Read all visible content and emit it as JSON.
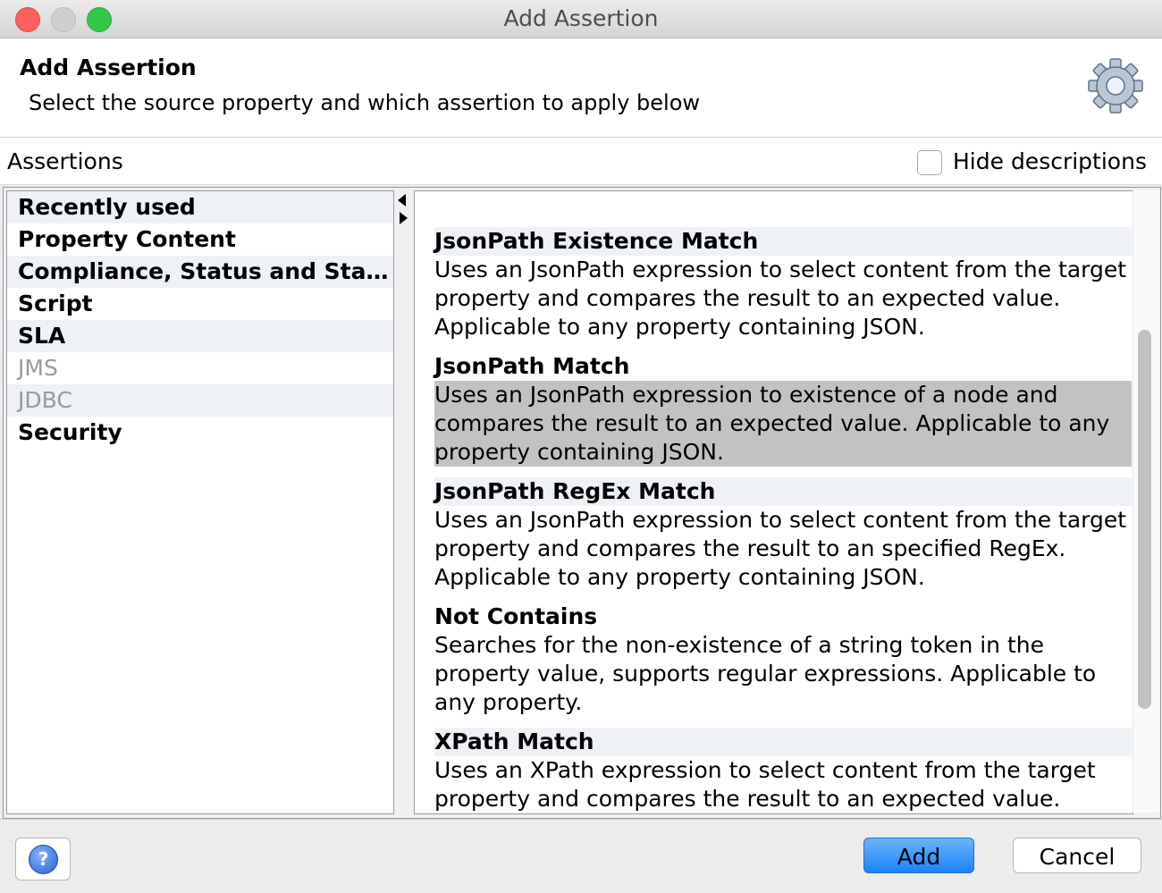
{
  "window": {
    "title": "Add Assertion"
  },
  "header": {
    "title": "Add Assertion",
    "subtitle": "Select the source property and which assertion to apply below",
    "icon": "gear-icon"
  },
  "assertions_bar": {
    "label": "Assertions",
    "hide_descriptions_label": "Hide descriptions",
    "hide_descriptions_checked": false
  },
  "categories": [
    {
      "label": "Recently used",
      "enabled": true
    },
    {
      "label": "Property Content",
      "enabled": true
    },
    {
      "label": "Compliance, Status and Standards",
      "enabled": true
    },
    {
      "label": "Script",
      "enabled": true
    },
    {
      "label": "SLA",
      "enabled": true
    },
    {
      "label": "JMS",
      "enabled": false
    },
    {
      "label": "JDBC",
      "enabled": false
    },
    {
      "label": "Security",
      "enabled": true
    }
  ],
  "assertion_list": [
    {
      "title": "JsonPath Existence Match",
      "description": "Uses an JsonPath expression to select content from the target property and compares the result to an expected value. Applicable to any property containing JSON.",
      "selected": false
    },
    {
      "title": "JsonPath Match",
      "description": "Uses an JsonPath expression to existence of a node and compares the result to an expected value. Applicable to any property containing JSON.",
      "selected": true
    },
    {
      "title": "JsonPath RegEx Match",
      "description": "Uses an JsonPath expression to select content from the target property and compares the result to an specified RegEx. Applicable to any property containing JSON.",
      "selected": false
    },
    {
      "title": "Not Contains",
      "description": "Searches for the non-existence of a string token in the property value, supports regular expressions. Applicable to any property.",
      "selected": false
    },
    {
      "title": "XPath Match",
      "description": "Uses an XPath expression to select content from the target property and compares the result to an expected value.",
      "selected": false
    }
  ],
  "footer": {
    "help_icon": "help-icon",
    "help_glyph": "?",
    "add_label": "Add",
    "cancel_label": "Cancel"
  }
}
